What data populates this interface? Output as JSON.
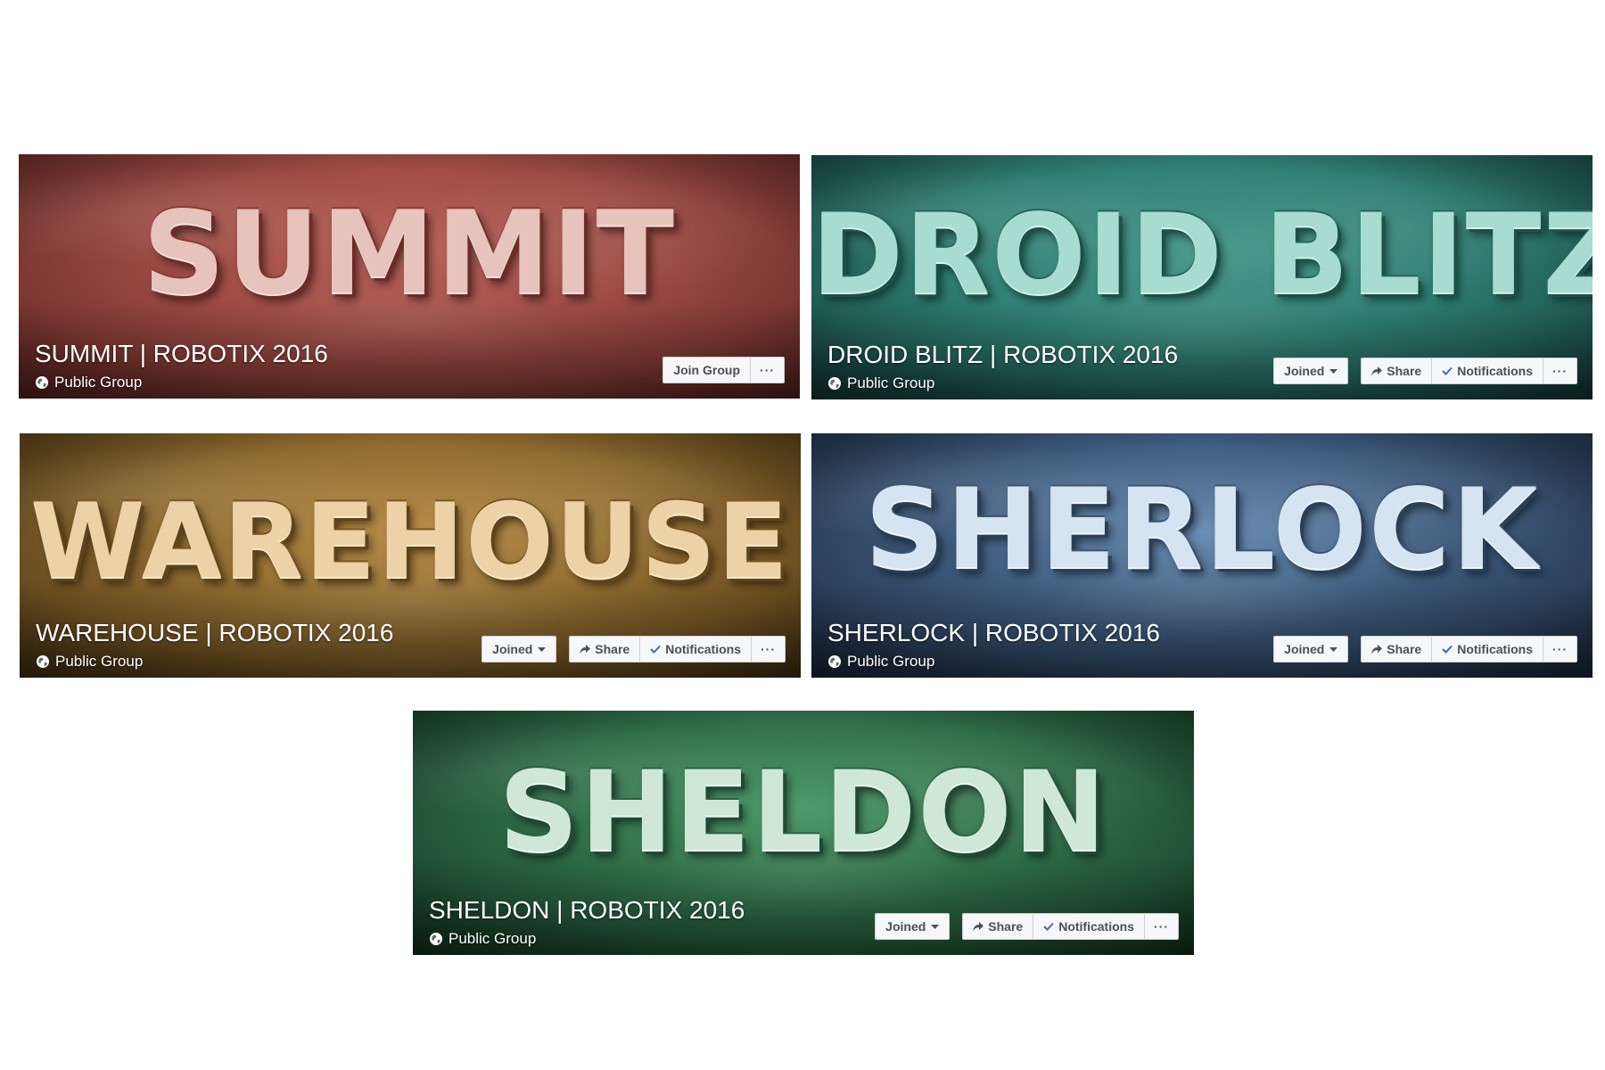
{
  "covers": [
    {
      "big_title": "SUMMIT",
      "group_name": "SUMMIT | ROBOTIX 2016",
      "privacy": "Public Group",
      "theme_color": "#9c4a43",
      "buttons": {
        "join": "Join Group",
        "more": "···"
      }
    },
    {
      "big_title": "DROID BLITZ",
      "group_name": "DROID BLITZ | ROBOTIX 2016",
      "privacy": "Public Group",
      "theme_color": "#2f7f74",
      "buttons": {
        "joined": "Joined",
        "share": "Share",
        "notifications": "Notifications",
        "more": "···"
      }
    },
    {
      "big_title": "WAREHOUSE",
      "group_name": "WAREHOUSE | ROBOTIX 2016",
      "privacy": "Public Group",
      "theme_color": "#8e6a2f",
      "buttons": {
        "joined": "Joined",
        "share": "Share",
        "notifications": "Notifications",
        "more": "···"
      }
    },
    {
      "big_title": "SHERLOCK",
      "group_name": "SHERLOCK | ROBOTIX 2016",
      "privacy": "Public Group",
      "theme_color": "#3d5a7c",
      "buttons": {
        "joined": "Joined",
        "share": "Share",
        "notifications": "Notifications",
        "more": "···"
      }
    },
    {
      "big_title": "SHELDON",
      "group_name": "SHELDON | ROBOTIX 2016",
      "privacy": "Public Group",
      "theme_color": "#2f6e48",
      "buttons": {
        "joined": "Joined",
        "share": "Share",
        "notifications": "Notifications",
        "more": "···"
      }
    }
  ]
}
